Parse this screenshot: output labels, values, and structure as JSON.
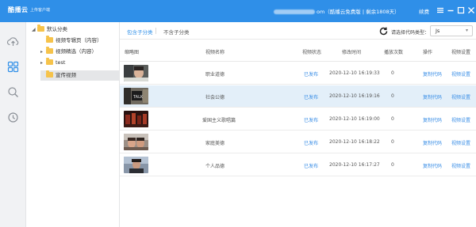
{
  "app": {
    "logo": "酷播云",
    "subtitle": "上传客户端",
    "account_suffix": "om（酷播云免费版 | 剩余1808天）",
    "renew": "续费",
    "window_controls": [
      "menu-icon",
      "minimize-icon",
      "maximize-icon",
      "close-icon"
    ]
  },
  "nav": {
    "items": [
      "upload-cloud-icon",
      "grid-icon",
      "search-icon",
      "history-icon"
    ]
  },
  "tree": {
    "root": "默认分类",
    "children": [
      {
        "label": "视频专辑页（内容）",
        "expandable": false
      },
      {
        "label": "视频精选（内容）",
        "expandable": true
      },
      {
        "label": "test",
        "expandable": true
      },
      {
        "label": "宣传视频",
        "expandable": false,
        "selected": true
      }
    ]
  },
  "toolbar": {
    "tab_include": "包含子分类",
    "tab_exclude": "不含子分类",
    "codetype_label": "请选择代码类型：",
    "codetype_value": "Js"
  },
  "table": {
    "columns": [
      "缩略图",
      "视频名称",
      "视频状态",
      "修改时间",
      "播放次数",
      "操作",
      "视频设置"
    ],
    "rows": [
      {
        "name": "职业道德",
        "status": "已发布",
        "time": "2020-12-10 16:19:33",
        "plays": "0",
        "op": "复制代码",
        "setting": "视频设置"
      },
      {
        "name": "社会公德",
        "status": "已发布",
        "time": "2020-12-10 16:19:16",
        "plays": "0",
        "op": "复制代码",
        "setting": "视频设置",
        "selected": true
      },
      {
        "name": "爱国主义歌唱篇",
        "status": "已发布",
        "time": "2020-12-10 16:19:00",
        "plays": "0",
        "op": "复制代码",
        "setting": "视频设置"
      },
      {
        "name": "家庭美德",
        "status": "已发布",
        "time": "2020-12-10 16:18:22",
        "plays": "0",
        "op": "复制代码",
        "setting": "视频设置"
      },
      {
        "name": "个人品德",
        "status": "已发布",
        "time": "2020-12-10 16:17:27",
        "plays": "0",
        "op": "复制代码",
        "setting": "视频设置"
      }
    ]
  },
  "colors": {
    "titlebar": "#2f8fe8",
    "accent": "#3a8ee6",
    "selected_row": "#e3eff9",
    "selected_node": "#e5e6e8",
    "folder": "#f6c34b"
  }
}
